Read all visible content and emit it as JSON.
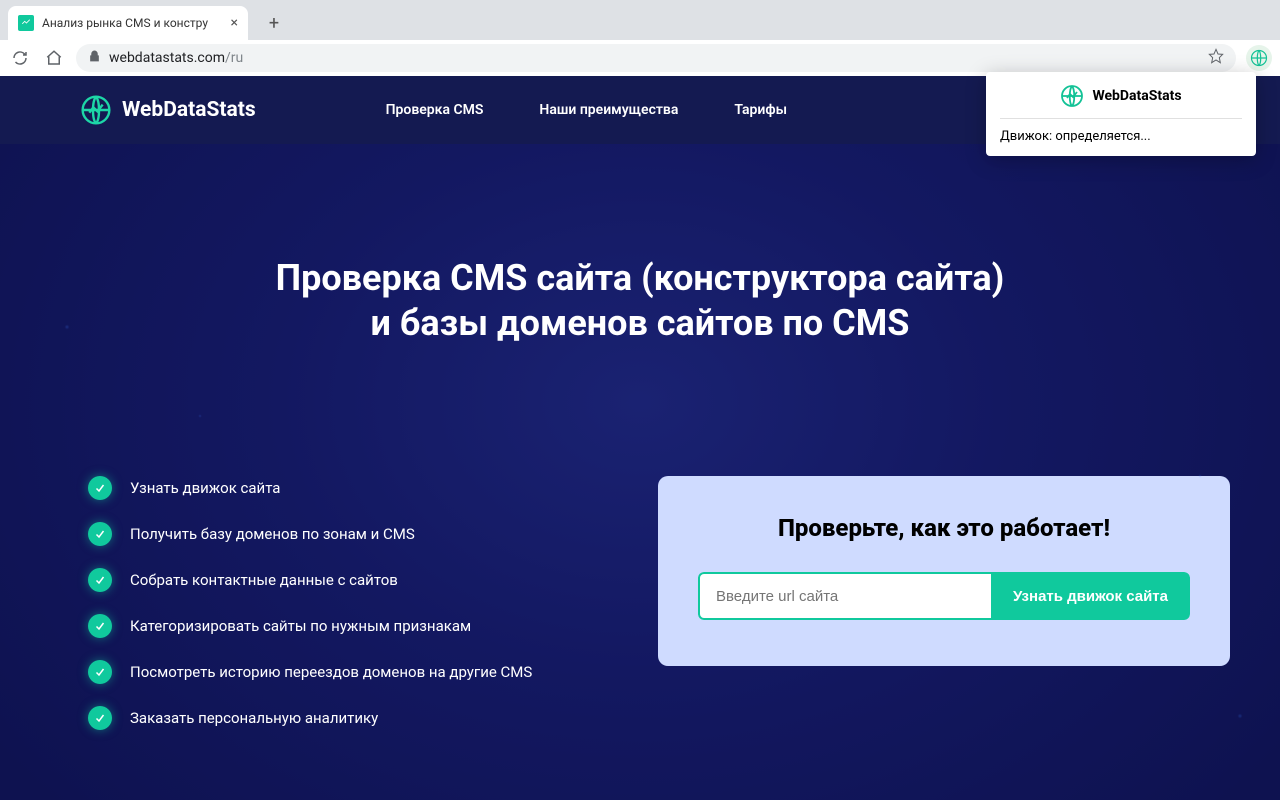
{
  "browser": {
    "tab_title": "Анализ рынка CMS и констру",
    "url_domain": "webdatastats.com",
    "url_path": "/ru"
  },
  "extension": {
    "name": "WebDataStats",
    "status_text": "Движок: определяется..."
  },
  "header": {
    "brand": "WebDataStats",
    "nav": {
      "cms_check": "Проверка CMS",
      "advantages": "Наши преимущества",
      "pricing": "Тарифы"
    }
  },
  "hero": {
    "title_line1": "Проверка CMS сайта (конструктора сайта)",
    "title_line2": "и базы доменов сайтов по CMS"
  },
  "features": [
    "Узнать движок сайта",
    "Получить базу доменов по зонам и CMS",
    "Собрать контактные данные с сайтов",
    "Категоризировать сайты по нужным признакам",
    "Посмотреть историю переездов доменов на другие CMS",
    "Заказать персональную аналитику"
  ],
  "demo": {
    "heading": "Проверьте, как это работает!",
    "placeholder": "Введите url сайта",
    "button": "Узнать движок сайта"
  }
}
